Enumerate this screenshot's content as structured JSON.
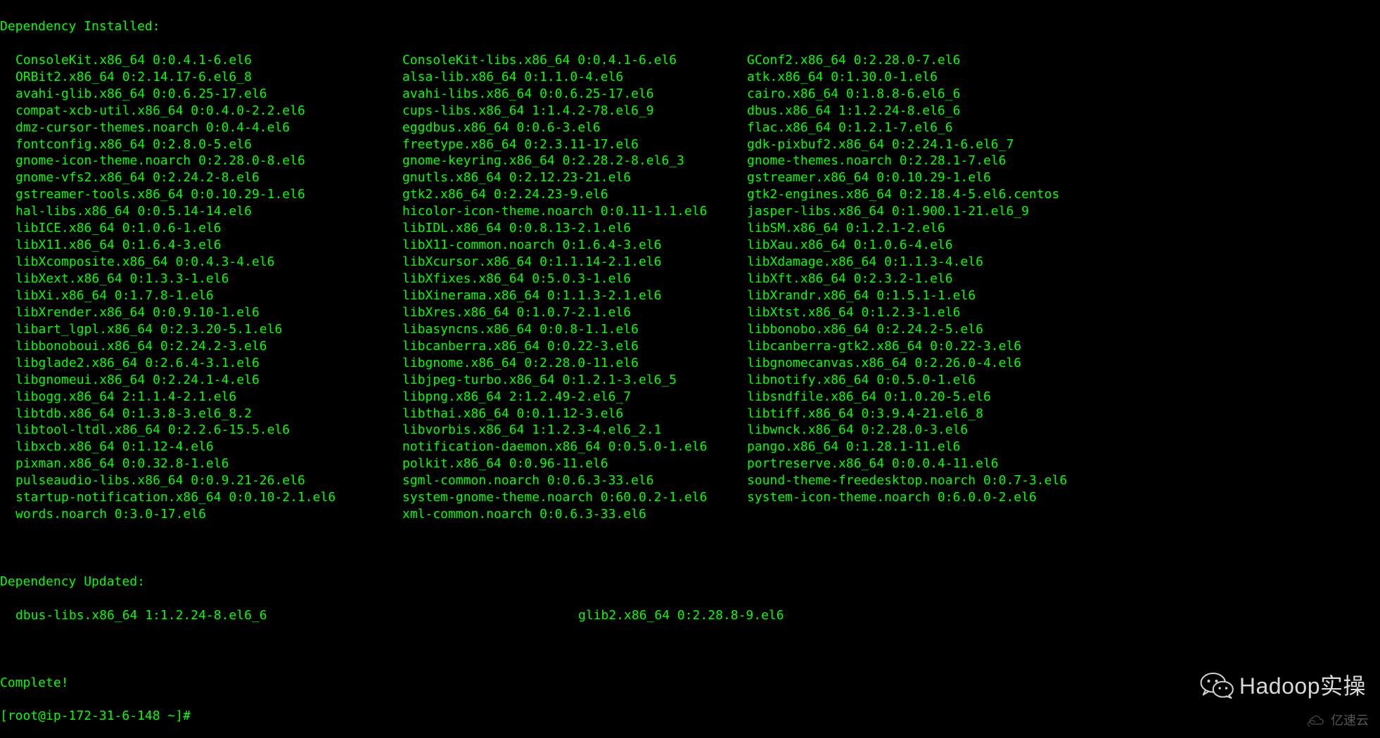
{
  "header_installed": "Dependency Installed:",
  "installed": [
    [
      "ConsoleKit.x86_64 0:0.4.1-6.el6",
      "ConsoleKit-libs.x86_64 0:0.4.1-6.el6",
      "GConf2.x86_64 0:2.28.0-7.el6"
    ],
    [
      "ORBit2.x86_64 0:2.14.17-6.el6_8",
      "alsa-lib.x86_64 0:1.1.0-4.el6",
      "atk.x86_64 0:1.30.0-1.el6"
    ],
    [
      "avahi-glib.x86_64 0:0.6.25-17.el6",
      "avahi-libs.x86_64 0:0.6.25-17.el6",
      "cairo.x86_64 0:1.8.8-6.el6_6"
    ],
    [
      "compat-xcb-util.x86_64 0:0.4.0-2.2.el6",
      "cups-libs.x86_64 1:1.4.2-78.el6_9",
      "dbus.x86_64 1:1.2.24-8.el6_6"
    ],
    [
      "dmz-cursor-themes.noarch 0:0.4-4.el6",
      "eggdbus.x86_64 0:0.6-3.el6",
      "flac.x86_64 0:1.2.1-7.el6_6"
    ],
    [
      "fontconfig.x86_64 0:2.8.0-5.el6",
      "freetype.x86_64 0:2.3.11-17.el6",
      "gdk-pixbuf2.x86_64 0:2.24.1-6.el6_7"
    ],
    [
      "gnome-icon-theme.noarch 0:2.28.0-8.el6",
      "gnome-keyring.x86_64 0:2.28.2-8.el6_3",
      "gnome-themes.noarch 0:2.28.1-7.el6"
    ],
    [
      "gnome-vfs2.x86_64 0:2.24.2-8.el6",
      "gnutls.x86_64 0:2.12.23-21.el6",
      "gstreamer.x86_64 0:0.10.29-1.el6"
    ],
    [
      "gstreamer-tools.x86_64 0:0.10.29-1.el6",
      "gtk2.x86_64 0:2.24.23-9.el6",
      "gtk2-engines.x86_64 0:2.18.4-5.el6.centos"
    ],
    [
      "hal-libs.x86_64 0:0.5.14-14.el6",
      "hicolor-icon-theme.noarch 0:0.11-1.1.el6",
      "jasper-libs.x86_64 0:1.900.1-21.el6_9"
    ],
    [
      "libICE.x86_64 0:1.0.6-1.el6",
      "libIDL.x86_64 0:0.8.13-2.1.el6",
      "libSM.x86_64 0:1.2.1-2.el6"
    ],
    [
      "libX11.x86_64 0:1.6.4-3.el6",
      "libX11-common.noarch 0:1.6.4-3.el6",
      "libXau.x86_64 0:1.0.6-4.el6"
    ],
    [
      "libXcomposite.x86_64 0:0.4.3-4.el6",
      "libXcursor.x86_64 0:1.1.14-2.1.el6",
      "libXdamage.x86_64 0:1.1.3-4.el6"
    ],
    [
      "libXext.x86_64 0:1.3.3-1.el6",
      "libXfixes.x86_64 0:5.0.3-1.el6",
      "libXft.x86_64 0:2.3.2-1.el6"
    ],
    [
      "libXi.x86_64 0:1.7.8-1.el6",
      "libXinerama.x86_64 0:1.1.3-2.1.el6",
      "libXrandr.x86_64 0:1.5.1-1.el6"
    ],
    [
      "libXrender.x86_64 0:0.9.10-1.el6",
      "libXres.x86_64 0:1.0.7-2.1.el6",
      "libXtst.x86_64 0:1.2.3-1.el6"
    ],
    [
      "libart_lgpl.x86_64 0:2.3.20-5.1.el6",
      "libasyncns.x86_64 0:0.8-1.1.el6",
      "libbonobo.x86_64 0:2.24.2-5.el6"
    ],
    [
      "libbonoboui.x86_64 0:2.24.2-3.el6",
      "libcanberra.x86_64 0:0.22-3.el6",
      "libcanberra-gtk2.x86_64 0:0.22-3.el6"
    ],
    [
      "libglade2.x86_64 0:2.6.4-3.1.el6",
      "libgnome.x86_64 0:2.28.0-11.el6",
      "libgnomecanvas.x86_64 0:2.26.0-4.el6"
    ],
    [
      "libgnomeui.x86_64 0:2.24.1-4.el6",
      "libjpeg-turbo.x86_64 0:1.2.1-3.el6_5",
      "libnotify.x86_64 0:0.5.0-1.el6"
    ],
    [
      "libogg.x86_64 2:1.1.4-2.1.el6",
      "libpng.x86_64 2:1.2.49-2.el6_7",
      "libsndfile.x86_64 0:1.0.20-5.el6"
    ],
    [
      "libtdb.x86_64 0:1.3.8-3.el6_8.2",
      "libthai.x86_64 0:0.1.12-3.el6",
      "libtiff.x86_64 0:3.9.4-21.el6_8"
    ],
    [
      "libtool-ltdl.x86_64 0:2.2.6-15.5.el6",
      "libvorbis.x86_64 1:1.2.3-4.el6_2.1",
      "libwnck.x86_64 0:2.28.0-3.el6"
    ],
    [
      "libxcb.x86_64 0:1.12-4.el6",
      "notification-daemon.x86_64 0:0.5.0-1.el6",
      "pango.x86_64 0:1.28.1-11.el6"
    ],
    [
      "pixman.x86_64 0:0.32.8-1.el6",
      "polkit.x86_64 0:0.96-11.el6",
      "portreserve.x86_64 0:0.0.4-11.el6"
    ],
    [
      "pulseaudio-libs.x86_64 0:0.9.21-26.el6",
      "sgml-common.noarch 0:0.6.3-33.el6",
      "sound-theme-freedesktop.noarch 0:0.7-3.el6"
    ],
    [
      "startup-notification.x86_64 0:0.10-2.1.el6",
      "system-gnome-theme.noarch 0:60.0.2-1.el6",
      "system-icon-theme.noarch 0:6.0.0-2.el6"
    ],
    [
      "words.noarch 0:3.0-17.el6",
      "xml-common.noarch 0:0.6.3-33.el6",
      ""
    ]
  ],
  "header_updated": "Dependency Updated:",
  "updated": [
    [
      "dbus-libs.x86_64 1:1.2.24-8.el6_6",
      "glib2.x86_64 0:2.28.8-9.el6"
    ]
  ],
  "complete": "Complete!",
  "prompt": "[root@ip-172-31-6-148 ~]#",
  "watermark": {
    "wechat_label": "Hadoop实操",
    "yisu_label": "亿速云"
  }
}
